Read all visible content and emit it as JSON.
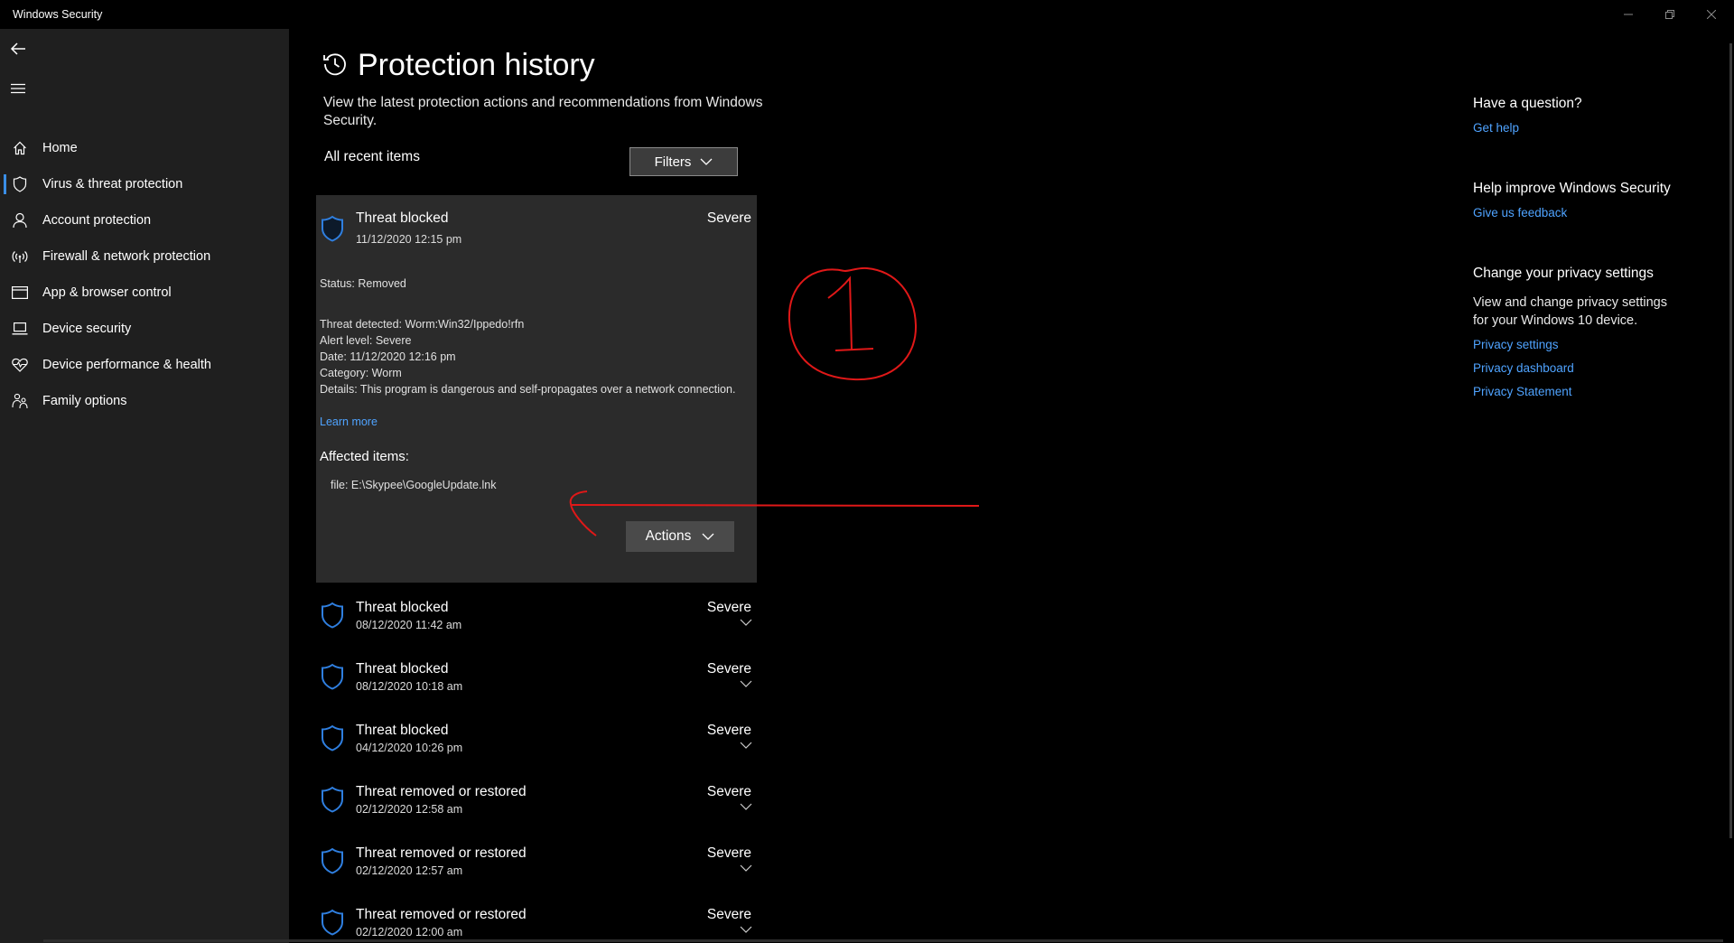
{
  "window": {
    "title": "Windows Security",
    "controls": [
      "minimize-icon",
      "restore-icon",
      "close-icon"
    ]
  },
  "sidebar": {
    "back_icon": "back-arrow-icon",
    "menu_icon": "hamburger-icon",
    "items": [
      {
        "label": "Home",
        "icon": "home-icon"
      },
      {
        "label": "Virus & threat protection",
        "icon": "shield-icon",
        "active": true
      },
      {
        "label": "Account protection",
        "icon": "person-icon"
      },
      {
        "label": "Firewall & network protection",
        "icon": "wifi-icon"
      },
      {
        "label": "App & browser control",
        "icon": "window-icon"
      },
      {
        "label": "Device security",
        "icon": "laptop-icon"
      },
      {
        "label": "Device performance & health",
        "icon": "heart-icon"
      },
      {
        "label": "Family options",
        "icon": "family-icon"
      }
    ]
  },
  "main": {
    "title": "Protection history",
    "description": "View the latest protection actions and recommendations from Windows Security.",
    "section_label": "All recent items",
    "filters_label": "Filters",
    "expanded_item": {
      "title": "Threat blocked",
      "date": "11/12/2020 12:15 pm",
      "severity": "Severe",
      "status": "Status: Removed",
      "threat_detected": "Threat detected:  Worm:Win32/Ippedo!rfn",
      "alert_level": "Alert level:  Severe",
      "detail_date": "Date:  11/12/2020 12:16 pm",
      "category": "Category:  Worm",
      "details": "Details:  This program is dangerous and self-propagates over a network connection.",
      "learn_more": "Learn more",
      "affected_label": "Affected items:",
      "affected_file": "file: E:\\Skypee\\GoogleUpdate.lnk",
      "actions_label": "Actions"
    },
    "items": [
      {
        "title": "Threat blocked",
        "date": "08/12/2020 11:42 am",
        "severity": "Severe"
      },
      {
        "title": "Threat blocked",
        "date": "08/12/2020 10:18 am",
        "severity": "Severe"
      },
      {
        "title": "Threat blocked",
        "date": "04/12/2020 10:26 pm",
        "severity": "Severe"
      },
      {
        "title": "Threat removed or restored",
        "date": "02/12/2020 12:58 am",
        "severity": "Severe"
      },
      {
        "title": "Threat removed or restored",
        "date": "02/12/2020 12:57 am",
        "severity": "Severe"
      },
      {
        "title": "Threat removed or restored",
        "date": "02/12/2020 12:00 am",
        "severity": "Severe"
      }
    ]
  },
  "right_panel": {
    "question_heading": "Have a question?",
    "get_help": "Get help",
    "improve_heading": "Help improve Windows Security",
    "feedback": "Give us feedback",
    "privacy_heading": "Change your privacy settings",
    "privacy_text": "View and change privacy settings for your Windows 10 device.",
    "privacy_settings": "Privacy settings",
    "privacy_dashboard": "Privacy dashboard",
    "privacy_statement": "Privacy Statement"
  },
  "colors": {
    "accent": "#3a8ee6",
    "link": "#4fa3ff",
    "annotation": "#e01818",
    "sidebar_bg": "#1f1f1f",
    "card_bg": "#2b2b2b"
  }
}
